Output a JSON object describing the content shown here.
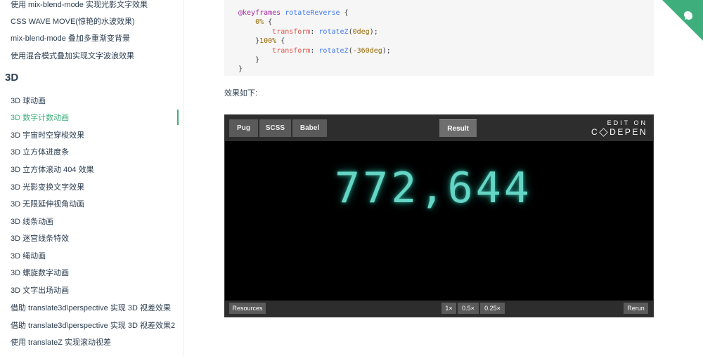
{
  "sidebar": {
    "top_items": [
      "使用 mix-blend-mode 实现光影文字效果",
      "CSS WAVE MOVE(惊艳的水波效果)",
      "mix-blend-mode 叠加多重渐变背景",
      "使用混合模式叠加实现文字波浪效果"
    ],
    "heading": "3D",
    "items": [
      "3D 球动画",
      "3D 数字计数动画",
      "3D 宇宙时空穿梭效果",
      "3D 立方体进度条",
      "3D 立方体滚动 404 效果",
      "3D 光影变换文字效果",
      "3D 无限延伸视角动画",
      "3D 线条动画",
      "3D 迷宫线条特效",
      "3D 绳动画",
      "3D 螺旋数字动画",
      "3D 文字出场动画",
      "借助 translate3d\\perspective 实现 3D 视差效果",
      "借助 translate3d\\perspective 实现 3D 视差效果2",
      "使用 translateZ 实现滚动视差"
    ],
    "active_index": 1
  },
  "code": {
    "keyword": "@keyframes",
    "name": "rotateReverse",
    "pct0": "0%",
    "pct100": "100%",
    "property": "transform",
    "fn": "rotateZ",
    "val0": "0deg",
    "val100": "-360deg"
  },
  "effect_label": "效果如下:",
  "embed": {
    "tabs": [
      "Pug",
      "SCSS",
      "Babel"
    ],
    "result_tab": "Result",
    "edit_on": "EDIT ON",
    "brand": "DEPEN",
    "display_value": "772,644",
    "resources": "Resources",
    "zoom": [
      "1×",
      "0.5×",
      "0.25×"
    ],
    "rerun": "Rerun"
  },
  "colors": {
    "accent": "#3eaf7c",
    "digit_glow": "#6ee8d6"
  }
}
